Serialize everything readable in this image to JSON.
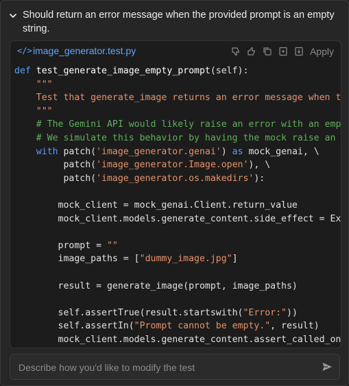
{
  "header": {
    "description": "Should return an error message when the provided prompt is an empty string."
  },
  "file": {
    "icon_text": "</>",
    "name": "image_generator.test.py",
    "apply_label": "Apply"
  },
  "code_lines": [
    [
      [
        "kw",
        "def "
      ],
      [
        "fn",
        "test_generate_image_empty_prompt"
      ],
      [
        "",
        "(self):"
      ]
    ],
    [
      [
        "",
        "    "
      ],
      [
        "st",
        "\"\"\""
      ]
    ],
    [
      [
        "",
        "    "
      ],
      [
        "st",
        "Test that generate_image returns an error message when t"
      ]
    ],
    [
      [
        "",
        "    "
      ],
      [
        "st",
        "\"\"\""
      ]
    ],
    [
      [
        "",
        "    "
      ],
      [
        "cm",
        "# The Gemini API would likely raise an error with an emp"
      ]
    ],
    [
      [
        "",
        "    "
      ],
      [
        "cm",
        "# We simulate this behavior by having the mock raise an"
      ]
    ],
    [
      [
        "",
        "    "
      ],
      [
        "kw",
        "with "
      ],
      [
        "",
        "patch("
      ],
      [
        "st",
        "'image_generator.genai'"
      ],
      [
        "",
        ") "
      ],
      [
        "kw",
        "as"
      ],
      [
        "",
        " mock_genai, \\"
      ]
    ],
    [
      [
        "",
        "         patch("
      ],
      [
        "st",
        "'image_generator.Image.open'"
      ],
      [
        "",
        "), \\"
      ]
    ],
    [
      [
        "",
        "         patch("
      ],
      [
        "st",
        "'image_generator.os.makedirs'"
      ],
      [
        "",
        "):"
      ]
    ],
    [
      [
        "",
        ""
      ]
    ],
    [
      [
        "",
        "        mock_client = mock_genai.Client.return_value"
      ]
    ],
    [
      [
        "",
        "        mock_client.models.generate_content.side_effect = Ex"
      ]
    ],
    [
      [
        "",
        ""
      ]
    ],
    [
      [
        "",
        "        prompt = "
      ],
      [
        "st",
        "\"\""
      ]
    ],
    [
      [
        "",
        "        image_paths = ["
      ],
      [
        "st",
        "\"dummy_image.jpg\""
      ],
      [
        "",
        "]"
      ]
    ],
    [
      [
        "",
        ""
      ]
    ],
    [
      [
        "",
        "        result = generate_image(prompt, image_paths)"
      ]
    ],
    [
      [
        "",
        ""
      ]
    ],
    [
      [
        "",
        "        self.assertTrue(result.startswith("
      ],
      [
        "st",
        "\"Error:\""
      ],
      [
        "",
        "))"
      ]
    ],
    [
      [
        "",
        "        self.assertIn("
      ],
      [
        "st",
        "\"Prompt cannot be empty.\""
      ],
      [
        "",
        ", result)"
      ]
    ],
    [
      [
        "",
        "        mock_client.models.generate_content.assert_called_on"
      ]
    ]
  ],
  "input": {
    "placeholder": "Describe how you'd like to modify the test"
  },
  "icons": {
    "collapse": "chevron-down-icon",
    "dislike": "thumbs-down-icon",
    "like": "thumbs-up-icon",
    "copy": "copy-icon",
    "insert": "insert-icon",
    "apply": "apply-file-icon",
    "send": "send-icon"
  }
}
